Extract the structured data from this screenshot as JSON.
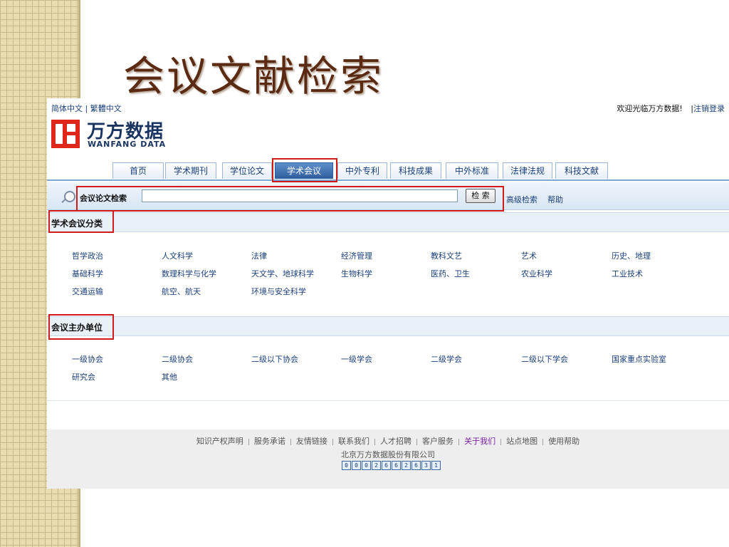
{
  "slide": {
    "title": "会议文献检索"
  },
  "lang": {
    "simplified": "简体中文",
    "sep": " | ",
    "traditional": "繁體中文"
  },
  "welcome": {
    "text": "欢迎光临万方数据!",
    "sep": "|",
    "logout": "注销登录"
  },
  "logo": {
    "cn": "万方数据",
    "en": "WANFANG DATA"
  },
  "nav": {
    "tabs": [
      {
        "label": "首页"
      },
      {
        "label": "学术期刊"
      },
      {
        "label": "学位论文"
      },
      {
        "label": "学术会议"
      },
      {
        "label": "中外专利"
      },
      {
        "label": "科技成果"
      },
      {
        "label": "中外标准"
      },
      {
        "label": "法律法规"
      },
      {
        "label": "科技文献"
      }
    ],
    "active": "学术会议"
  },
  "search": {
    "label": "会议论文检索",
    "value": "",
    "button": "检 索",
    "advanced": "高级检索",
    "help": "帮助"
  },
  "categories": {
    "title": "学术会议分类",
    "items": [
      "哲学政治",
      "人文科学",
      "法律",
      "经济管理",
      "教科文艺",
      "艺术",
      "历史、地理",
      "基础科学",
      "数理科学与化学",
      "天文学、地球科学",
      "生物科学",
      "医药、卫生",
      "农业科学",
      "工业技术",
      "交通运输",
      "航空、航天",
      "环境与安全科学"
    ]
  },
  "organizers": {
    "title": "会议主办单位",
    "items": [
      "一级协会",
      "二级协会",
      "二级以下协会",
      "一级学会",
      "二级学会",
      "二级以下学会",
      "国家重点实验室",
      "研究会",
      "其他"
    ]
  },
  "footer": {
    "links": [
      "知识产权声明",
      "服务承诺",
      "友情链接",
      "联系我们",
      "人才招聘",
      "客户服务",
      "关于我们",
      "站点地图",
      "使用帮助"
    ],
    "highlight": "关于我们",
    "company": "北京万方数据股份有限公司",
    "counter": [
      "0",
      "0",
      "0",
      "2",
      "6",
      "6",
      "2",
      "6",
      "3",
      "1"
    ]
  },
  "colors": {
    "accent": "#2e5d9d",
    "highlight_box": "#d11a1a",
    "title": "#5b2a12"
  }
}
